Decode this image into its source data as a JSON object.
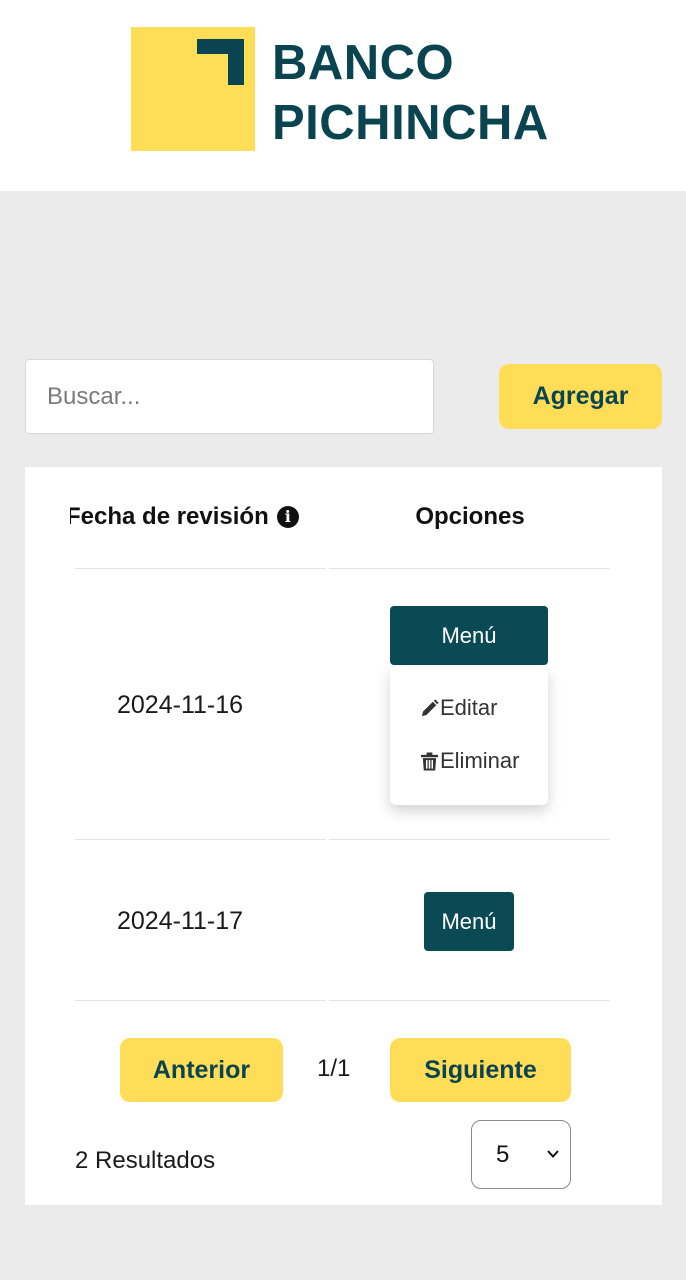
{
  "brand": {
    "line1": "BANCO",
    "line2": "PICHINCHA",
    "primary_color": "#0a4450",
    "accent_color": "#ffdd57"
  },
  "toolbar": {
    "search_placeholder": "Buscar...",
    "add_label": "Agregar"
  },
  "table": {
    "columns": [
      "Fecha de revisión",
      "Opciones"
    ],
    "rows": [
      {
        "date": "2024-11-16",
        "menu_label": "Menú",
        "menu_open": true
      },
      {
        "date": "2024-11-17",
        "menu_label": "Menú",
        "menu_open": false
      }
    ],
    "dropdown": {
      "edit_label": "Editar",
      "delete_label": "Eliminar",
      "edit_icon": "pencil-icon",
      "delete_icon": "trash-icon"
    }
  },
  "pagination": {
    "prev_label": "Anterior",
    "next_label": "Siguiente",
    "page_indicator": "1/1",
    "results_text": "2 Resultados",
    "page_size": "5"
  }
}
